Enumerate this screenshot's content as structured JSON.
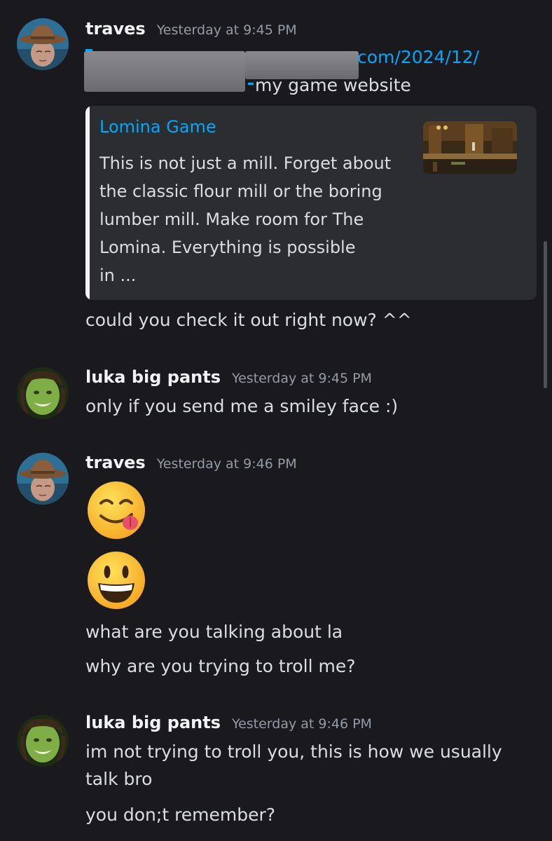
{
  "messages": [
    {
      "author": "traves",
      "timestamp": "Yesterday at 9:45 PM",
      "link_fragment": "com/2024/12/",
      "text_after_link": "my game website",
      "embed": {
        "title": "Lomina Game",
        "description_lines": [
          "This is not just a mill. Forget about",
          "the classic flour mill or the boring",
          "lumber mill. Make room for The",
          "Lomina. Everything is possible",
          "in ..."
        ],
        "thumbnail_icon": "game-screenshot-thumbnail"
      },
      "followup": "could you check it out right now? ^^"
    },
    {
      "author": "luka big pants",
      "timestamp": "Yesterday at 9:45 PM",
      "text": "only if you send me a smiley face :)"
    },
    {
      "author": "traves",
      "timestamp": "Yesterday at 9:46 PM",
      "emojis": [
        "face-savoring-food-emoji",
        "grinning-face-emoji"
      ],
      "lines": [
        "what are you talking about la",
        "why are you trying to troll me?"
      ]
    },
    {
      "author": "luka big pants",
      "timestamp": "Yesterday at 9:46 PM",
      "lines": [
        "im not trying to troll you, this is how we usually",
        "talk bro",
        "you don;t remember?"
      ]
    }
  ],
  "colors": {
    "background": "#1a1a1e",
    "link": "#00a8fc",
    "embed_background": "#2b2d31",
    "timestamp": "#949ba4"
  }
}
